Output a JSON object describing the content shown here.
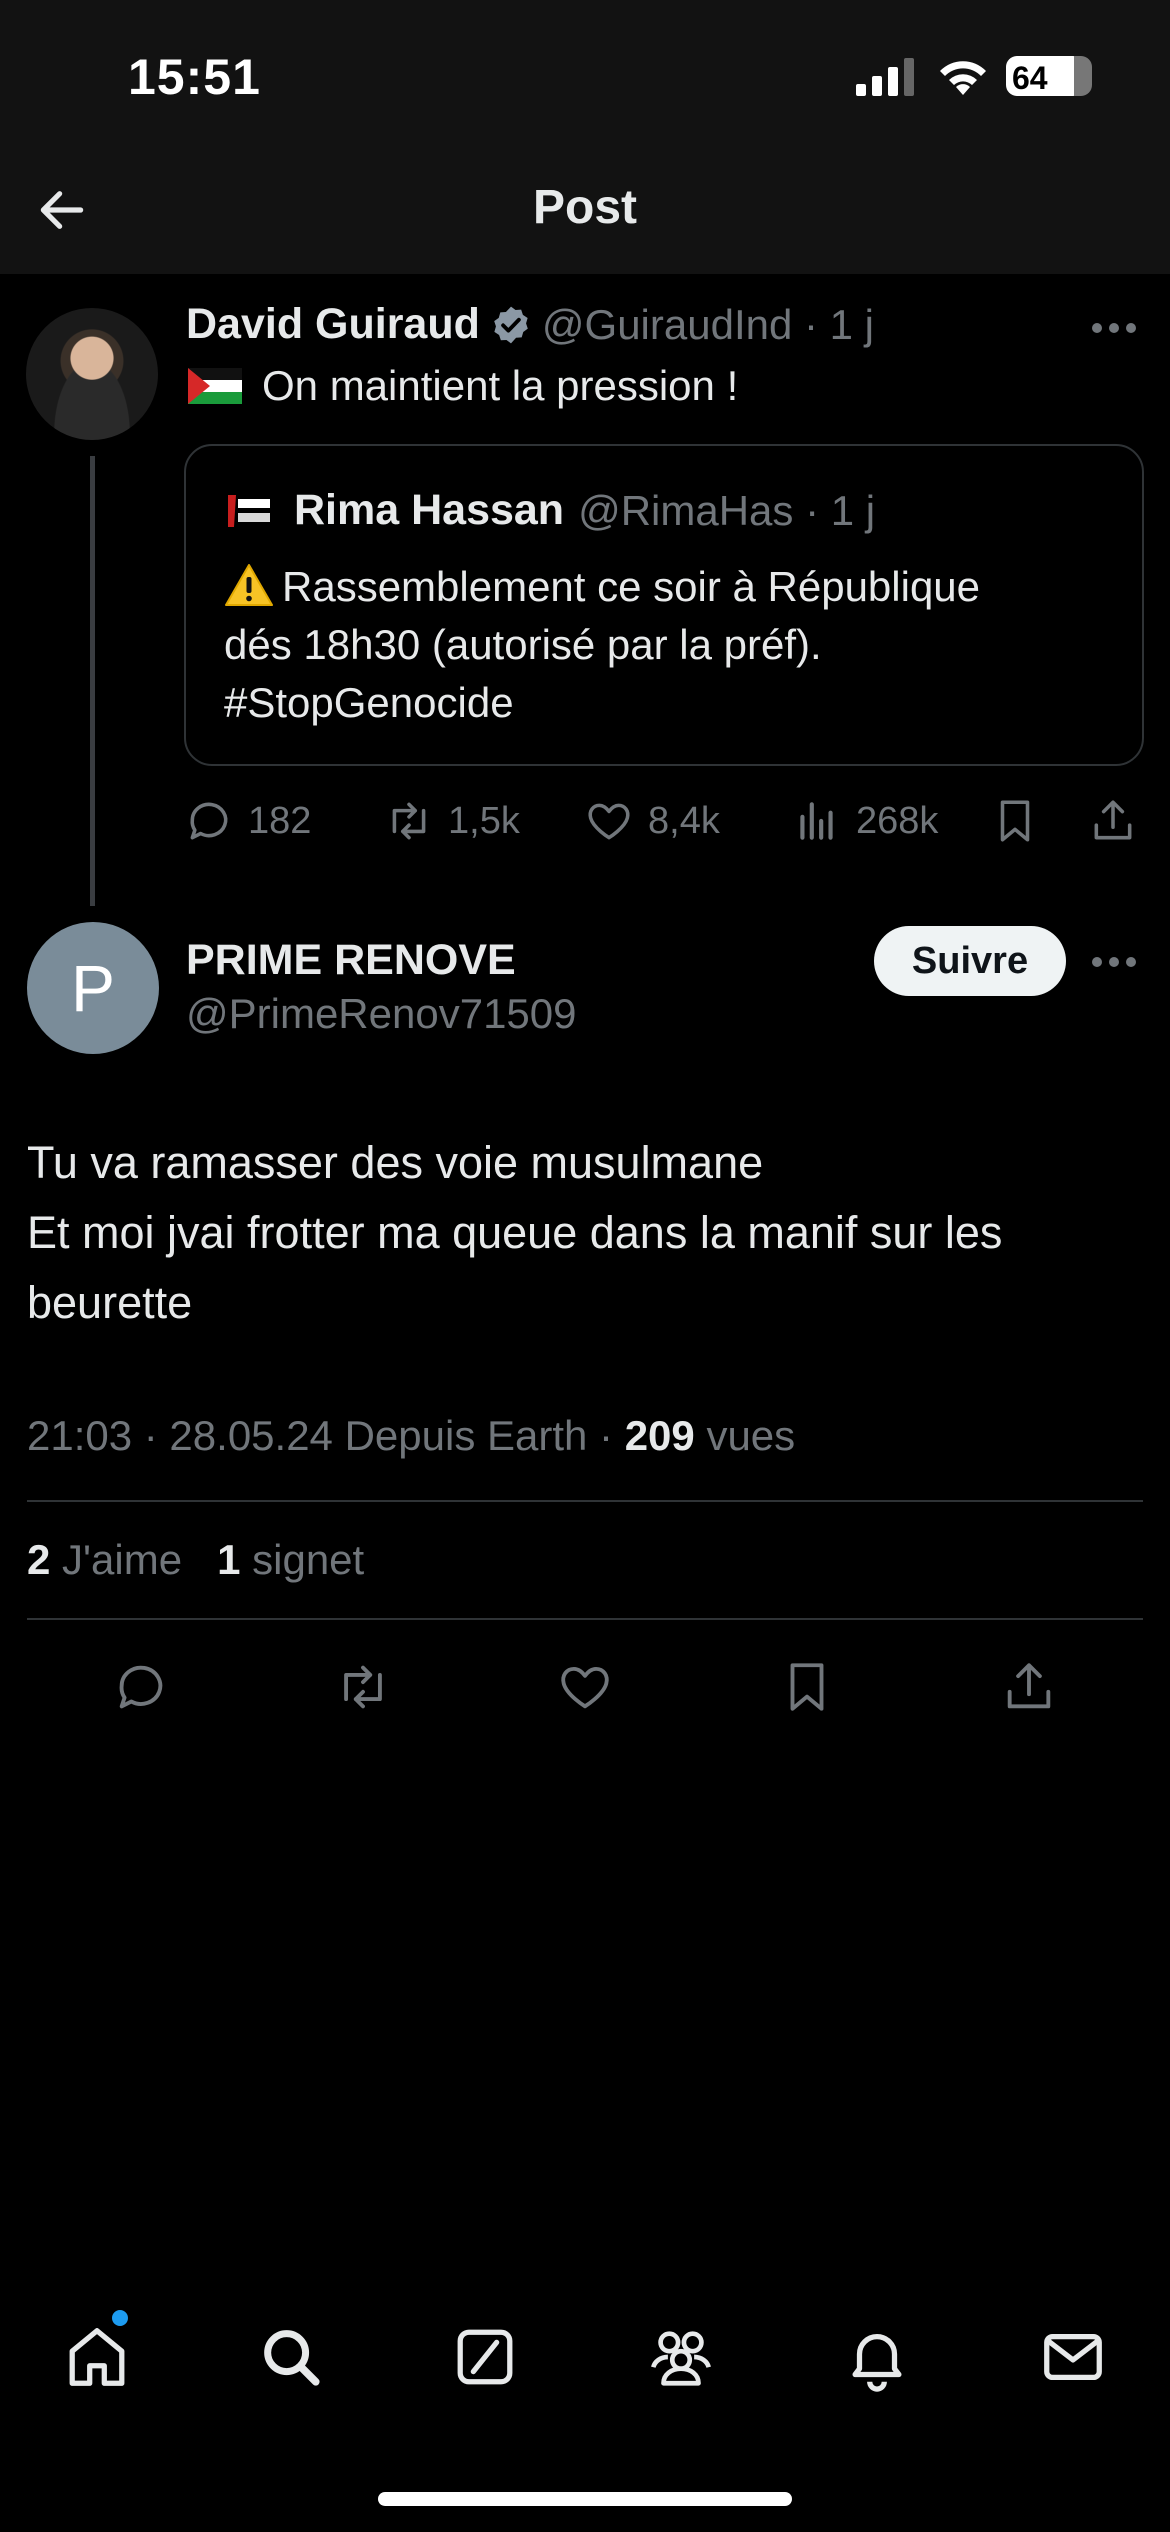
{
  "status_bar": {
    "time": "15:51",
    "battery": "64"
  },
  "header": {
    "title": "Post",
    "back_icon": "arrow-left-icon"
  },
  "parent_tweet": {
    "name": "David Guiraud",
    "handle_time": "@GuiraudInd · 1 j",
    "text": "On maintient la pression !",
    "quote": {
      "name": "Rima Hassan",
      "handle_time": "@RimaHas · 1 j",
      "lines": [
        "Rassemblement ce soir à République",
        "dés 18h30 (autorisé par la préf).",
        "#StopGenocide"
      ]
    },
    "actions": {
      "replies": "182",
      "reposts": "1,5k",
      "likes": "8,4k",
      "views": "268k"
    }
  },
  "reply_tweet": {
    "avatar_letter": "P",
    "name": "PRIME RENOVE",
    "handle": "@PrimeRenov71509",
    "follow_label": "Suivre",
    "lines": [
      "Tu va ramasser des voie musulmane",
      "Et moi jvai frotter ma queue dans la manif sur les",
      "beurette"
    ],
    "meta_prefix": "21:03 · 28.05.24 Depuis Earth · ",
    "views_count": "209",
    "views_label": " vues",
    "likes_count": "2",
    "likes_label": " J'aime",
    "bookmarks_count": "1",
    "bookmarks_label": " signet"
  },
  "colors": {
    "accent": "#1d9bf0",
    "muted": "#71767b",
    "text": "#e7e9ea",
    "bar": "#121212"
  }
}
